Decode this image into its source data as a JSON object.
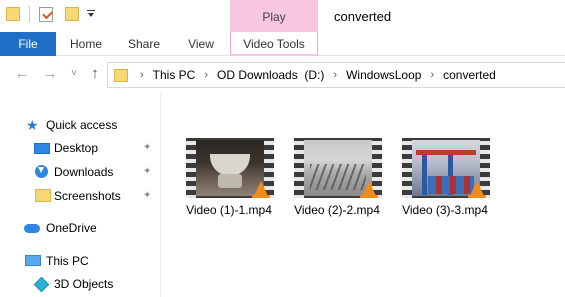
{
  "quick_access_toolbar": {
    "icons": [
      "folder-icon",
      "properties-icon",
      "new-folder-icon",
      "customize-dropdown-icon"
    ]
  },
  "contextual_tab_group": {
    "label": "Play",
    "color": "#f7c6e3"
  },
  "window": {
    "title": "converted"
  },
  "ribbon": {
    "tabs": [
      {
        "label": "File",
        "color": "#1f6fc7"
      },
      {
        "label": "Home"
      },
      {
        "label": "Share"
      },
      {
        "label": "View"
      },
      {
        "label": "Video Tools"
      }
    ]
  },
  "navigation": {
    "back_icon": "←",
    "forward_icon": "→",
    "recent_icon": "˅",
    "up_icon": "↑"
  },
  "address_bar": {
    "breadcrumb": [
      "This PC",
      "OD Downloads  (D:)",
      "WindowsLoop",
      "converted"
    ]
  },
  "nav_pane": {
    "items": [
      {
        "label": "Quick access",
        "icon": "star-icon"
      },
      {
        "label": "Desktop",
        "icon": "desktop-icon",
        "pinned": true
      },
      {
        "label": "Downloads",
        "icon": "downloads-icon",
        "pinned": true
      },
      {
        "label": "Screenshots",
        "icon": "folder-icon",
        "pinned": true
      },
      {
        "label": "OneDrive",
        "icon": "cloud-icon"
      },
      {
        "label": "This PC",
        "icon": "pc-icon"
      },
      {
        "label": "3D Objects",
        "icon": "3d-objects-icon"
      }
    ],
    "pin_glyph": "📌"
  },
  "files": [
    {
      "name": "Video (1)-1.mp4",
      "icon": "vlc-icon"
    },
    {
      "name": "Video (2)-2.mp4",
      "icon": "vlc-icon"
    },
    {
      "name": "Video (3)-3.mp4",
      "icon": "vlc-icon"
    }
  ]
}
